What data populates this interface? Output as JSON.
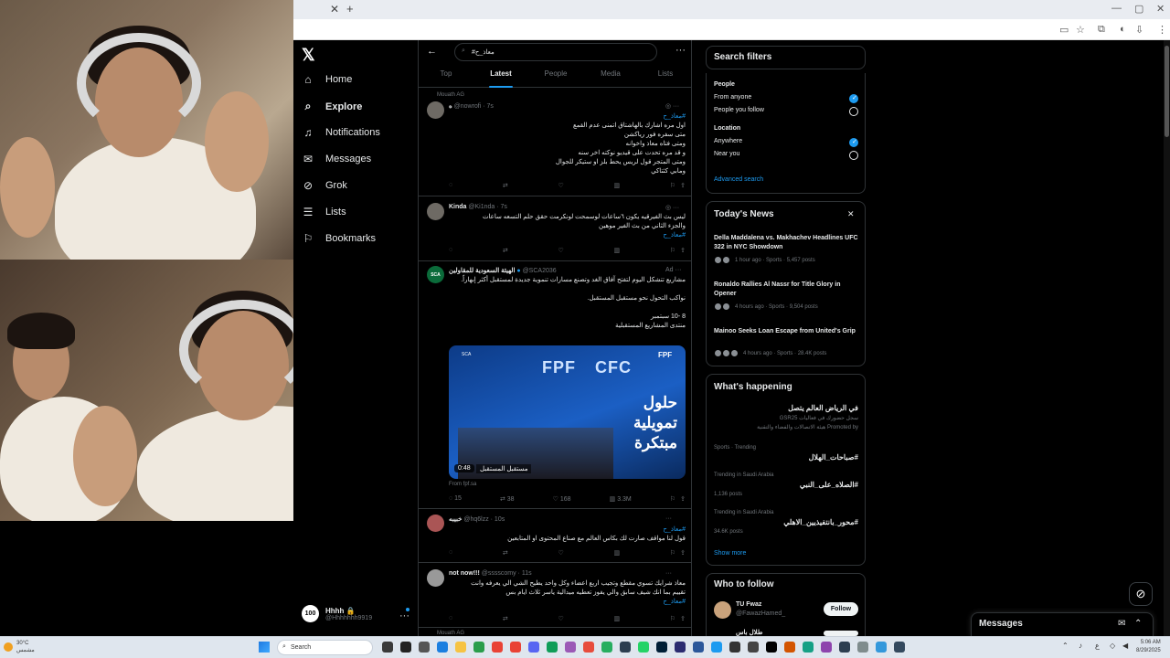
{
  "nav": {
    "items": [
      {
        "label": "Home",
        "icon": "home-icon"
      },
      {
        "label": "Explore",
        "icon": "search-icon"
      },
      {
        "label": "Notifications",
        "icon": "bell-icon"
      },
      {
        "label": "Messages",
        "icon": "envelope-icon"
      },
      {
        "label": "Grok",
        "icon": "grok-icon"
      },
      {
        "label": "Lists",
        "icon": "list-icon"
      },
      {
        "label": "Bookmarks",
        "icon": "bookmark-icon"
      }
    ],
    "account": {
      "avatar": "100",
      "name": "Hhhh 🔒",
      "handle": "@Hhhhhhh9919"
    }
  },
  "timeline": {
    "search_value": "#معاذ_ح",
    "tabs": [
      "Top",
      "Latest",
      "People",
      "Media",
      "Lists"
    ],
    "active_tab": "Latest",
    "tweets": [
      {
        "social": "Mouath AG",
        "name": "ه",
        "handle": "@nowrofi · 7s",
        "hashtag": "#معاذ_ح",
        "lines": [
          "اول مره اشارك بالهاشتاق اتمنى عدم القمع",
          "متى سفره فور رياكشن",
          "ومتى فتاه معاذ واخوانه",
          "و قد مره تحدت على قيديو نوكته اخر سنه",
          "ومتى المتجر قول لريس يحط بلز او ستيكر للجوال",
          "ومابي كثتاكي"
        ]
      },
      {
        "name": "Kinda",
        "handle": "@Ki1nda · 7s",
        "lines": [
          "ليس بث الفيرقيه يكون ٦ساعات لوسمحت لونكرمت حقق حلم التسعه ساعات",
          "والجزء الثاني من بث الفير موهين"
        ],
        "hashtag": "#معاذ_ح"
      },
      {
        "name": "الهيئة السعودية للمقاولين",
        "handle": "@SCA2036",
        "ad": "Ad",
        "avatar": "SCA",
        "lines": [
          "مشاريع تتشكل اليوم لتفتح آفاق الغد وتصنع مسارات تنموية جديدة لمستقبل أكثر إبهاراً.",
          "",
          "نواكب التحول نحو مستقبل المستقبل.",
          "",
          "8 -10 سبتمبر",
          "منتدى المشاريع المستقبلية"
        ],
        "media": {
          "logo1": "FPF",
          "logo2": "CFC",
          "headline": "حلول تمويلية مبتكرة",
          "duration": "0:48",
          "caption": "مستقبل المستقبل",
          "sca": "SCA",
          "fp": "FPF"
        },
        "from": "From fpf.sa",
        "stats": {
          "replies": "15",
          "reposts": "38",
          "likes": "168",
          "views": "3.3M"
        }
      },
      {
        "name": "خبيبه",
        "handle": "@hq6lzz · 10s",
        "hashtag": "#معاذ_ح",
        "lines": [
          "قول لنا مواقف صارت لك بكاس العالم مع صناع المحتوى او المتابعين"
        ]
      },
      {
        "name": "not now!!!",
        "handle": "@sssscomy · 11s",
        "lines": [
          "معاذ شرايك تسوي مقطع وتجيب اربع اعضاء وكل واحد يطيح الشي الي يعرفه وانت",
          "تقييم بما انك شيف سابق والي يفوز تعطيه ميدالية ياسر ثلاث ايام بس"
        ],
        "hashtag": "#معاذ_ح"
      },
      {
        "social": "Mouath AG"
      }
    ]
  },
  "filters": {
    "title": "Search filters",
    "people_label": "People",
    "people_options": [
      {
        "label": "From anyone",
        "selected": true
      },
      {
        "label": "People you follow",
        "selected": false
      }
    ],
    "location_label": "Location",
    "location_options": [
      {
        "label": "Anywhere",
        "selected": true
      },
      {
        "label": "Near you",
        "selected": false
      }
    ],
    "advanced": "Advanced search"
  },
  "news": {
    "title": "Today's News",
    "items": [
      {
        "title": "Della Maddalena vs. Makhachev Headlines UFC 322 in NYC Showdown",
        "meta": "1 hour ago · Sports · 5,457 posts"
      },
      {
        "title": "Ronaldo Rallies Al Nassr for Title Glory in Opener",
        "meta": "4 hours ago · Sports · 9,504 posts"
      },
      {
        "title": "Mainoo Seeks Loan Escape from United's Grip",
        "meta": "4 hours ago · Sports · 28.4K posts"
      }
    ]
  },
  "happening": {
    "title": "What's happening",
    "promo": {
      "name": "في الرياض العالم يتصل",
      "sub": "سجل حضورك في فعاليات GSR25",
      "promoted": "Promoted by هيئة الاتصالات والفضاء والتقنية"
    },
    "trends": [
      {
        "context": "Sports · Trending",
        "name": "#صباحات_الهلال",
        "count": ""
      },
      {
        "context": "Trending in Saudi Arabia",
        "name": "#الصلاه_على_النبي",
        "count": "1,136 posts"
      },
      {
        "context": "Trending in Saudi Arabia",
        "name": "#محور_بانتفيذيين_الاهلي",
        "count": "34.6K posts"
      }
    ],
    "show_more": "Show more"
  },
  "follow": {
    "title": "Who to follow",
    "items": [
      {
        "name": "TU Fwaz",
        "handle": "@FawazHamed_",
        "button": "Follow"
      },
      {
        "name": "طلال باس",
        "handle": "",
        "button": "Follow"
      }
    ]
  },
  "messages_drawer": {
    "title": "Messages"
  },
  "taskbar": {
    "weather_temp": "30°C",
    "weather_desc": "مشمس",
    "search": "Search",
    "time": "5:06 AM",
    "date": "8/29/2025",
    "lang": "ع"
  },
  "colors": {
    "accent": "#1d9bf0",
    "background": "#000000",
    "border": "#2f3336",
    "muted": "#71767b"
  }
}
